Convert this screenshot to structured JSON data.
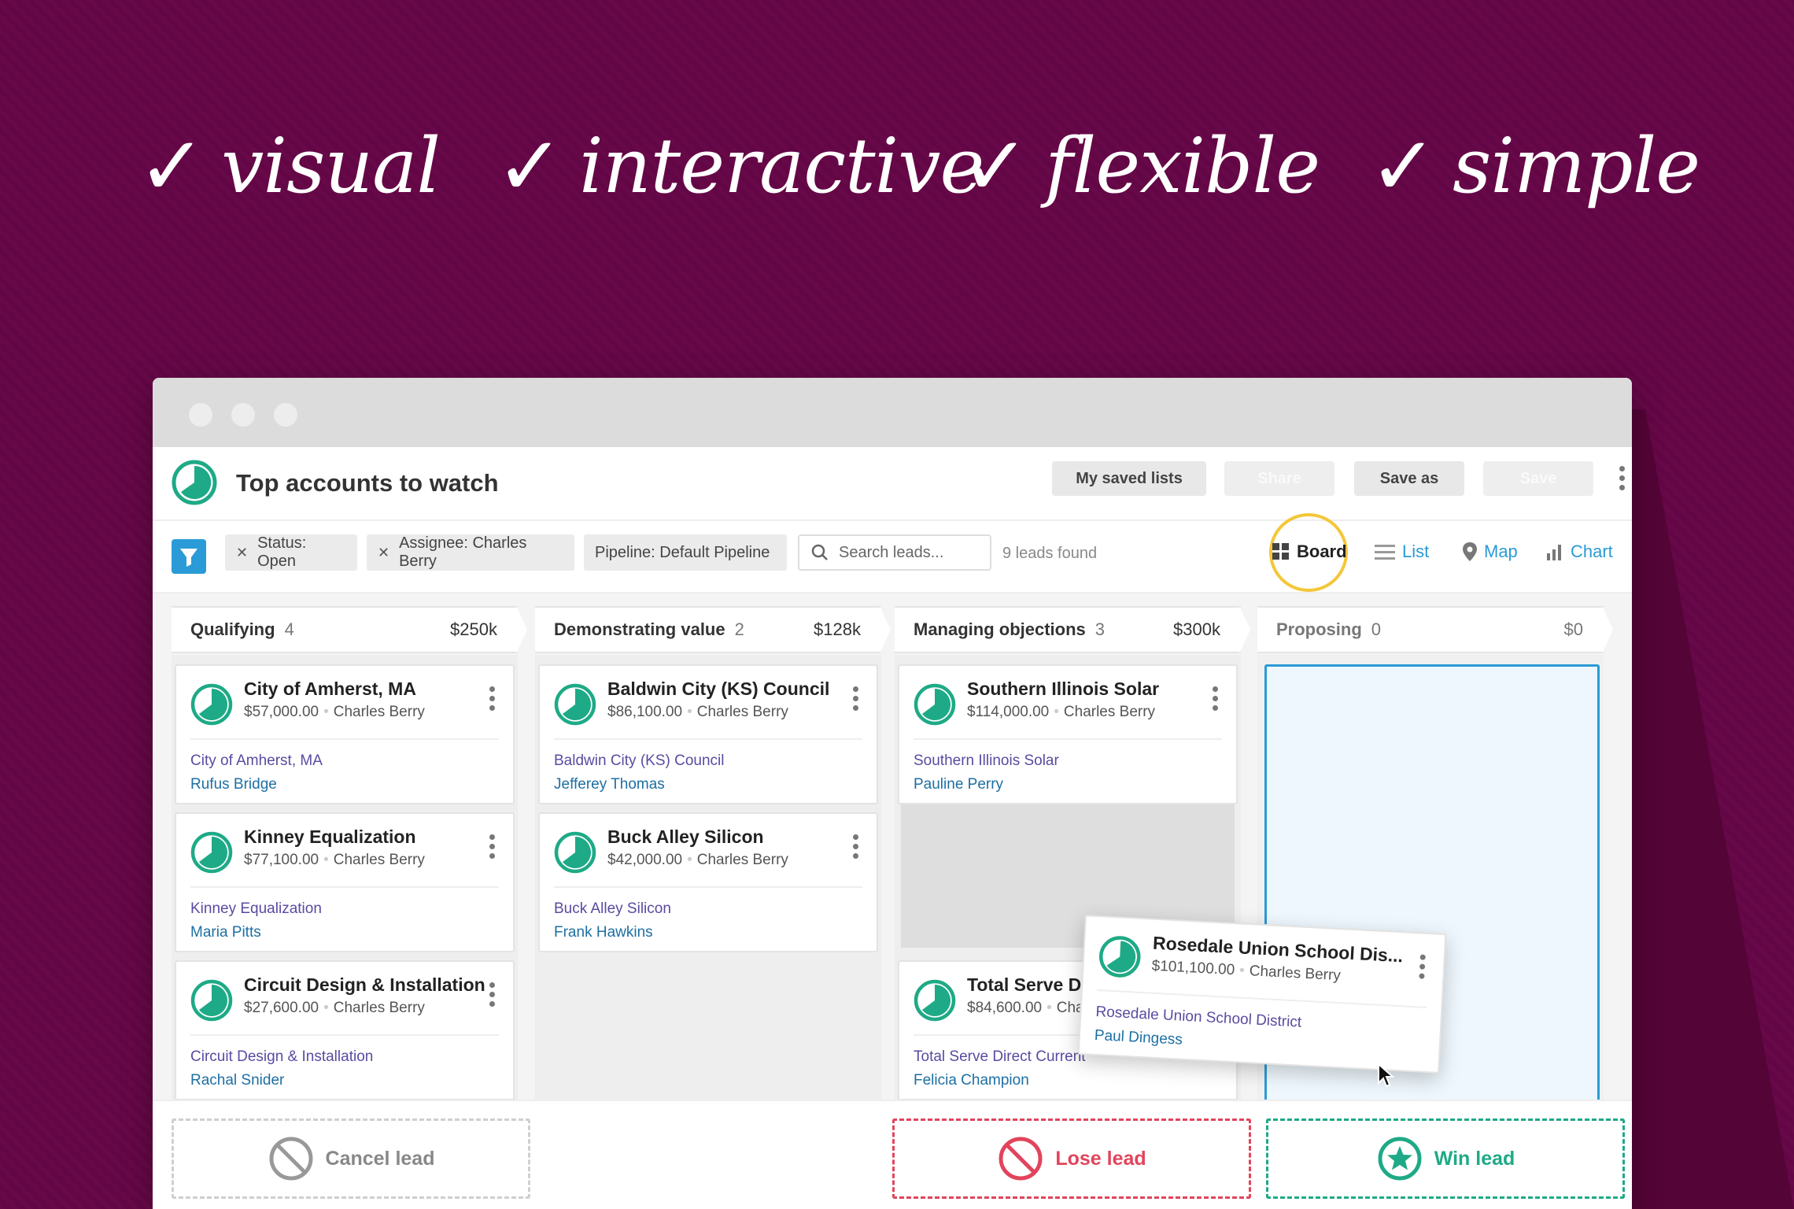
{
  "taglines": [
    {
      "check": "✓",
      "word": "visual"
    },
    {
      "check": "✓",
      "word": "interactive"
    },
    {
      "check": "✓",
      "word": "flexible"
    },
    {
      "check": "✓",
      "word": "simple"
    }
  ],
  "header": {
    "title": "Top accounts to watch",
    "buttons": {
      "saved_lists": "My saved lists",
      "share": "Share",
      "save_as": "Save as",
      "save": "Save"
    }
  },
  "filters": {
    "chips": [
      {
        "x": "✕",
        "label": "Status: Open"
      },
      {
        "x": "✕",
        "label": "Assignee: Charles Berry"
      },
      {
        "label": "Pipeline: Default Pipeline"
      }
    ],
    "search_placeholder": "Search leads...",
    "found": "9 leads found",
    "views": {
      "board": "Board",
      "list": "List",
      "map": "Map",
      "chart": "Chart"
    },
    "active_view": "Board"
  },
  "stages": [
    {
      "name": "Qualifying",
      "count": "4",
      "amount": "$250k"
    },
    {
      "name": "Demonstrating value",
      "count": "2",
      "amount": "$128k"
    },
    {
      "name": "Managing objections",
      "count": "3",
      "amount": "$300k"
    },
    {
      "name": "Proposing",
      "count": "0",
      "amount": "$0"
    }
  ],
  "cards": {
    "qualifying": [
      {
        "name": "City of Amherst, MA",
        "value": "$57,000.00",
        "owner": "Charles Berry",
        "company": "City of Amherst, MA",
        "contact": "Rufus Bridge"
      },
      {
        "name": "Kinney Equalization",
        "value": "$77,100.00",
        "owner": "Charles Berry",
        "company": "Kinney Equalization",
        "contact": "Maria Pitts"
      },
      {
        "name": "Circuit Design & Installation",
        "value": "$27,600.00",
        "owner": "Charles Berry",
        "company": "Circuit Design & Installation",
        "contact": "Rachal Snider"
      }
    ],
    "demonstrating": [
      {
        "name": "Baldwin City (KS) Council",
        "value": "$86,100.00",
        "owner": "Charles Berry",
        "company": "Baldwin City (KS) Council",
        "contact": "Jefferey Thomas"
      },
      {
        "name": "Buck Alley Silicon",
        "value": "$42,000.00",
        "owner": "Charles Berry",
        "company": "Buck Alley Silicon",
        "contact": "Frank Hawkins"
      }
    ],
    "objections": [
      {
        "name": "Southern Illinois Solar",
        "value": "$114,000.00",
        "owner": "Charles Berry",
        "company": "Southern Illinois Solar",
        "contact": "Pauline Perry"
      },
      {
        "name": "Total Serve Direct Current",
        "value": "$84,600.00",
        "owner": "Charles Berry",
        "company": "Total Serve Direct Current",
        "contact": "Felicia Champion"
      }
    ],
    "dragging": {
      "name": "Rosedale Union School Dis...",
      "value": "$101,100.00",
      "owner": "Charles Berry",
      "company": "Rosedale Union School District",
      "contact": "Paul Dingess"
    }
  },
  "dropzones": {
    "cancel": "Cancel lead",
    "lose": "Lose lead",
    "win": "Win lead"
  },
  "colors": {
    "background": "#650646",
    "accent": "#2a9bd6",
    "lose": "#e2445c",
    "win": "#1eaa86",
    "highlight": "#f4c73a"
  }
}
